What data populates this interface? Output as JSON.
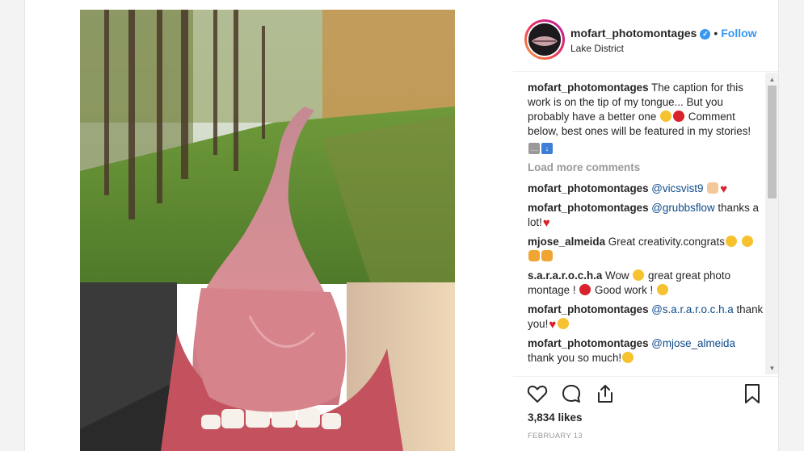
{
  "post": {
    "username": "mofart_photomontages",
    "verified_icon": "✓",
    "separator": "•",
    "follow_label": "Follow",
    "location": "Lake District",
    "likes": "3,834 likes",
    "date": "FEBRUARY 13"
  },
  "caption": {
    "user": "mofart_photomontages",
    "text": "The caption for this work is on the tip of my tongue... But you probably have a better one",
    "text2": "Comment below, best ones will be featured in my stories!"
  },
  "load_more": "Load more comments",
  "comments": [
    {
      "user": "mofart_photomontages",
      "mention": "@vicsvist9",
      "text": ""
    },
    {
      "user": "mofart_photomontages",
      "mention": "@grubbsflow",
      "text": "thanks a lot!"
    },
    {
      "user": "mjose_almeida",
      "mention": "",
      "text": "Great creativity.congrats"
    },
    {
      "user": "s.a.r.a.r.o.c.h.a",
      "mention": "",
      "text": "Wow",
      "text_b": "great great photo montage !",
      "text_c": "Good work !"
    },
    {
      "user": "mofart_photomontages",
      "mention": "@s.a.r.a.r.o.c.h.a",
      "text": "thank you!"
    },
    {
      "user": "mofart_photomontages",
      "mention": "@mjose_almeida",
      "text": "thank you so much!"
    }
  ],
  "icons": {
    "like": "heart-outline-icon",
    "comment": "speech-bubble-icon",
    "share": "share-upload-icon",
    "save": "bookmark-icon"
  },
  "colors": {
    "accent": "#3897f0",
    "mention": "#0d4a8b",
    "muted": "#999999"
  }
}
